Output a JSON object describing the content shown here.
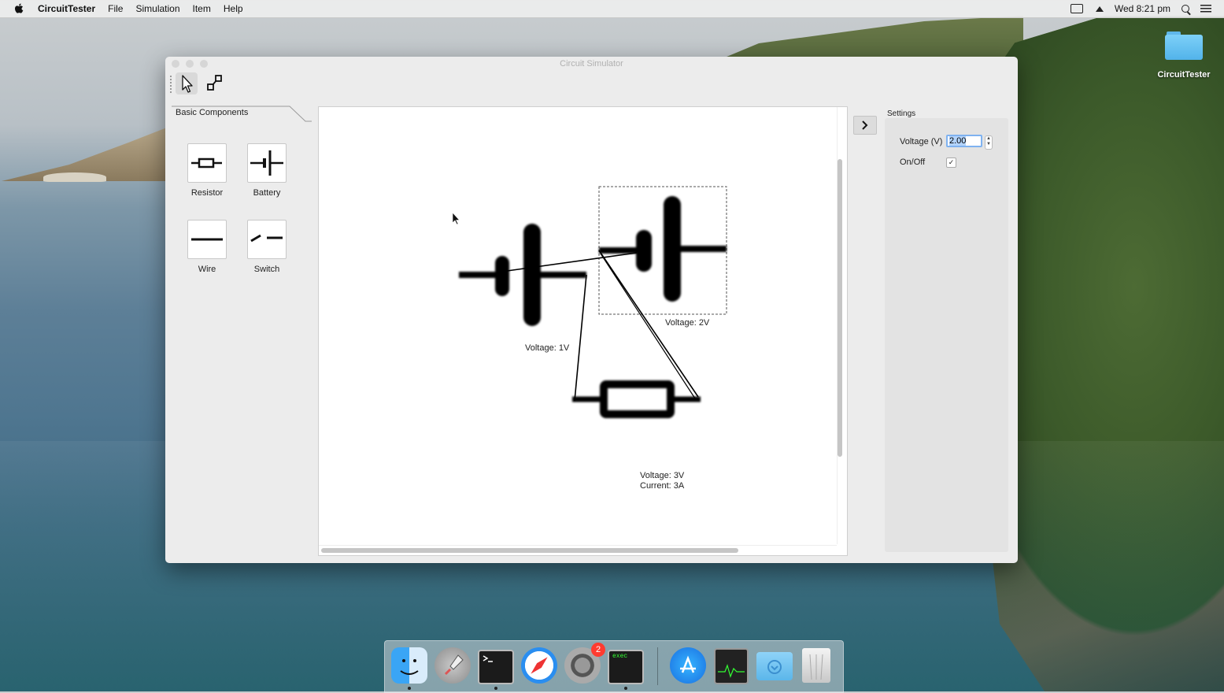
{
  "menubar": {
    "app_name": "CircuitTester",
    "items": [
      "File",
      "Simulation",
      "Item",
      "Help"
    ],
    "clock": "Wed 8:21 pm"
  },
  "desktop": {
    "folder_label": "CircuitTester"
  },
  "window": {
    "title": "Circuit Simulator",
    "toolbar": {
      "tools": [
        "pointer-tool",
        "connect-tool"
      ]
    }
  },
  "sidebar": {
    "tab_label": "Basic Components",
    "components": [
      {
        "label": "Resistor",
        "icon": "resistor-icon"
      },
      {
        "label": "Battery",
        "icon": "battery-icon"
      },
      {
        "label": "Wire",
        "icon": "wire-icon"
      },
      {
        "label": "Switch",
        "icon": "switch-icon"
      }
    ]
  },
  "canvas": {
    "labels": {
      "battery1": "Voltage: 1V",
      "battery2": "Voltage: 2V",
      "resistor_voltage": "Voltage: 3V",
      "resistor_current": "Current: 3A"
    }
  },
  "settings": {
    "title": "Settings",
    "voltage_label": "Voltage (V)",
    "voltage_value": "2.00",
    "onoff_label": "On/Off",
    "onoff_checked": true,
    "check_glyph": "✓"
  },
  "dock": {
    "apps": [
      "Finder",
      "Launchpad",
      "Terminal",
      "Safari",
      "System Preferences",
      "exec",
      "App Store",
      "Activity Monitor",
      "Downloads",
      "Trash"
    ],
    "system_prefs_badge": "2",
    "exec_label": "exec"
  },
  "colors": {
    "accent": "#7fb2f0",
    "selection": "#b3d4fc",
    "badge": "#ff3b30"
  }
}
